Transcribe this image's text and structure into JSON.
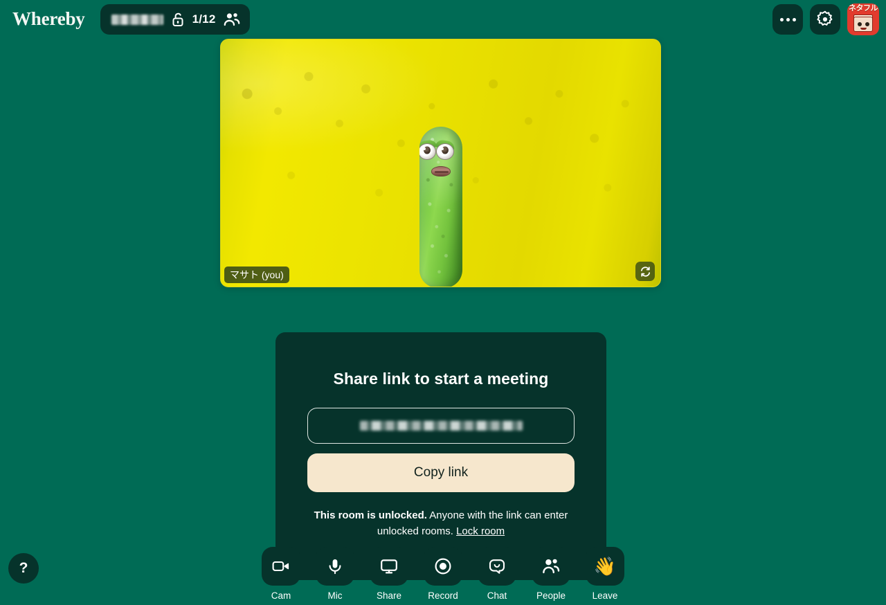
{
  "colors": {
    "background": "#006b55",
    "panel": "#06332b",
    "accent_button": "#f6e7cd",
    "text": "#ffffff",
    "video_brine": "#ece400",
    "pickle_green": "#6cc23c",
    "avatar_red": "#e23b2e"
  },
  "header": {
    "brand": "Whereby",
    "room_name_redacted": true,
    "lock_icon": "unlocked-padlock-icon",
    "participant_count": "1/12",
    "people_icon": "people-icon",
    "more_icon": "more-options-icon",
    "settings_icon": "gear-icon",
    "avatar": {
      "icon": "user-avatar-icon",
      "label": "ネタフル"
    }
  },
  "video": {
    "participant_name": "マサト (you)",
    "flip_icon": "flip-camera-icon",
    "filter": "pickle-face-filter"
  },
  "share_panel": {
    "title": "Share link to start a meeting",
    "link_value_redacted": true,
    "copy_label": "Copy link",
    "lock_note_bold": "This room is unlocked.",
    "lock_note_rest": " Anyone with the link can enter unlocked rooms. ",
    "lock_link_label": "Lock room"
  },
  "toolbar": {
    "items": [
      {
        "label": "Cam",
        "icon": "video-camera-icon"
      },
      {
        "label": "Mic",
        "icon": "microphone-icon"
      },
      {
        "label": "Share",
        "icon": "screen-share-icon"
      },
      {
        "label": "Record",
        "icon": "record-icon"
      },
      {
        "label": "Chat",
        "icon": "chat-bubble-icon"
      },
      {
        "label": "People",
        "icon": "people-icon"
      },
      {
        "label": "Leave",
        "icon": "waving-hand-icon",
        "emoji": "👋"
      }
    ]
  },
  "help": {
    "label": "?",
    "icon": "help-icon"
  }
}
